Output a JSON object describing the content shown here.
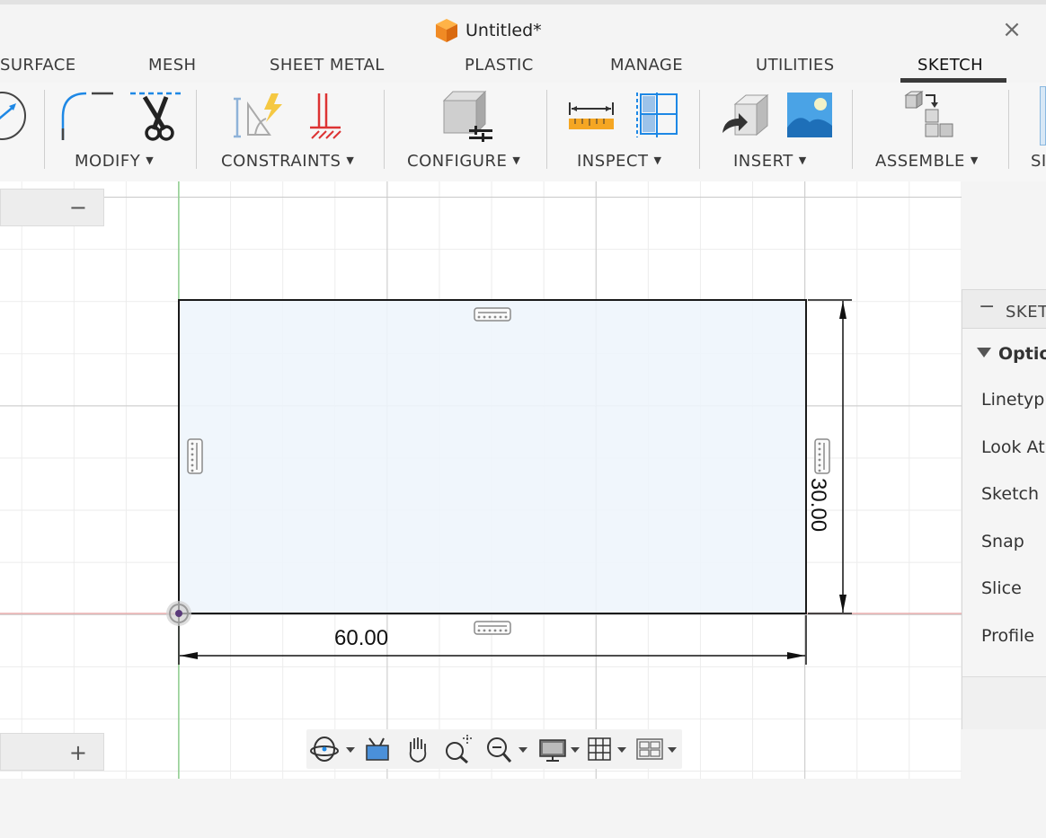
{
  "window": {
    "title": "Untitled*",
    "close_label": "×"
  },
  "tabs": [
    {
      "label": "SURFACE"
    },
    {
      "label": "MESH"
    },
    {
      "label": "SHEET METAL"
    },
    {
      "label": "PLASTIC"
    },
    {
      "label": "MANAGE"
    },
    {
      "label": "UTILITIES"
    },
    {
      "label": "SKETCH",
      "active": true
    }
  ],
  "ribbon": {
    "groups": [
      {
        "label": "MODIFY"
      },
      {
        "label": "CONSTRAINTS"
      },
      {
        "label": "CONFIGURE"
      },
      {
        "label": "INSPECT"
      },
      {
        "label": "INSERT"
      },
      {
        "label": "ASSEMBLE"
      },
      {
        "label": "SI"
      }
    ],
    "icons": [
      "sketch-offset-icon",
      "fillet-icon",
      "trim-icon",
      "constraints-icon",
      "fix-constraint-icon",
      "configure-icon",
      "measure-icon",
      "interference-icon",
      "insert-derive-icon",
      "insert-image-icon",
      "assemble-component-icon"
    ]
  },
  "left_panel": {
    "collapse_label": "−",
    "expand_label": "+"
  },
  "sketch": {
    "width_dimension": "60.00",
    "height_dimension": "30.00",
    "colors": {
      "profile_fill": "#eef5fc",
      "line": "#1a1a1a",
      "x_axis": "#e8a0a0",
      "y_axis": "#7ed07e"
    }
  },
  "sketch_palette": {
    "minimize_label": "−",
    "title": "SKETC",
    "section": "Optio",
    "rows": [
      "Linetyp",
      "Look At",
      "Sketch",
      "Snap",
      "Slice",
      "Profile"
    ]
  },
  "navbar": {
    "icons": [
      "orbit-icon",
      "look-at-icon",
      "pan-icon",
      "zoom-window-icon",
      "zoom-icon",
      "display-settings-icon",
      "grid-icon",
      "viewports-icon"
    ]
  }
}
